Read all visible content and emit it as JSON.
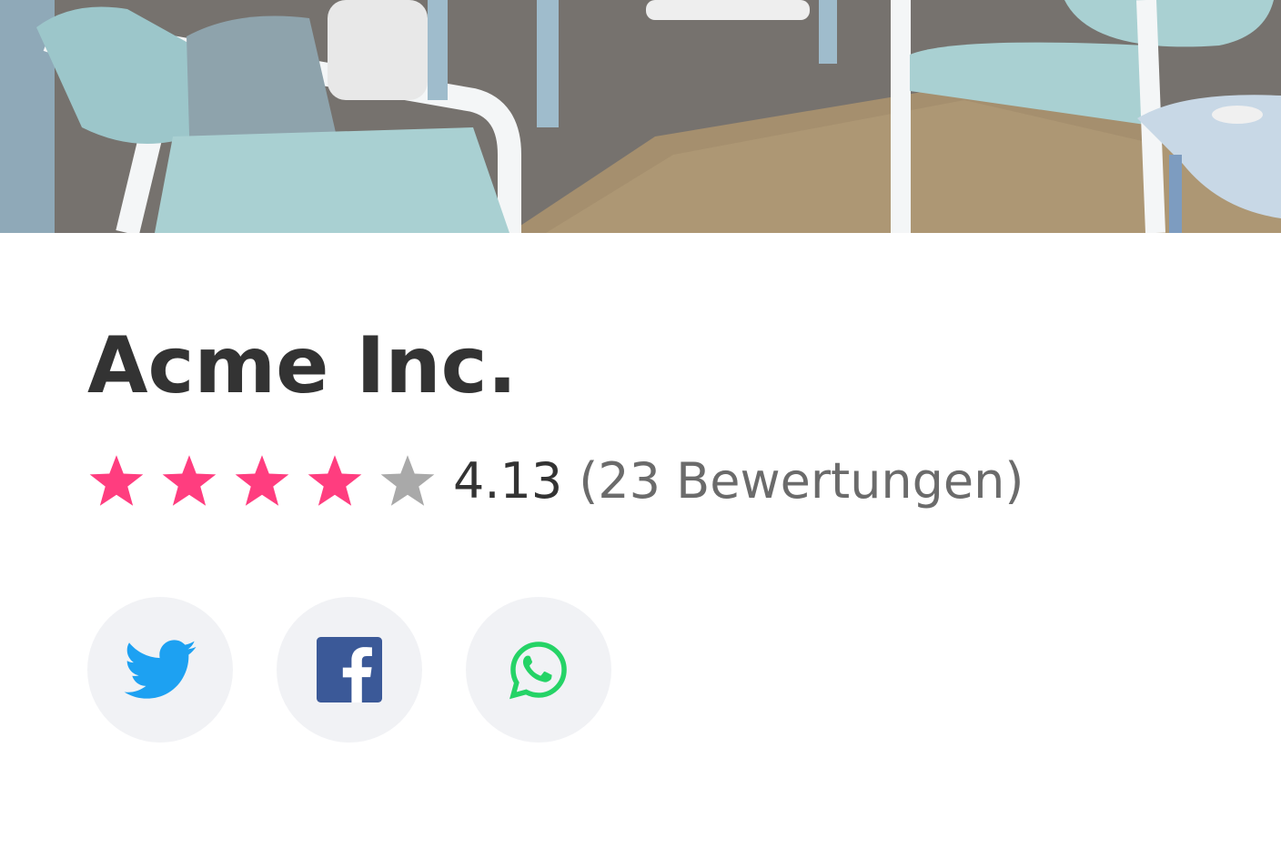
{
  "company": {
    "name": "Acme Inc."
  },
  "rating": {
    "value": "4.13",
    "count_text": "(23 Bewertungen)",
    "stars_filled": 4,
    "stars_total": 5,
    "filled_color": "#ff3d7f",
    "empty_color": "#a9a9a9"
  },
  "share": [
    {
      "network": "twitter",
      "icon": "twitter-icon",
      "color": "#1da1f2"
    },
    {
      "network": "facebook",
      "icon": "facebook-icon",
      "color": "#3b5998"
    },
    {
      "network": "whatsapp",
      "icon": "whatsapp-icon",
      "color": "#25d366"
    }
  ],
  "hero": {
    "image": "lounge-interior-photo"
  }
}
